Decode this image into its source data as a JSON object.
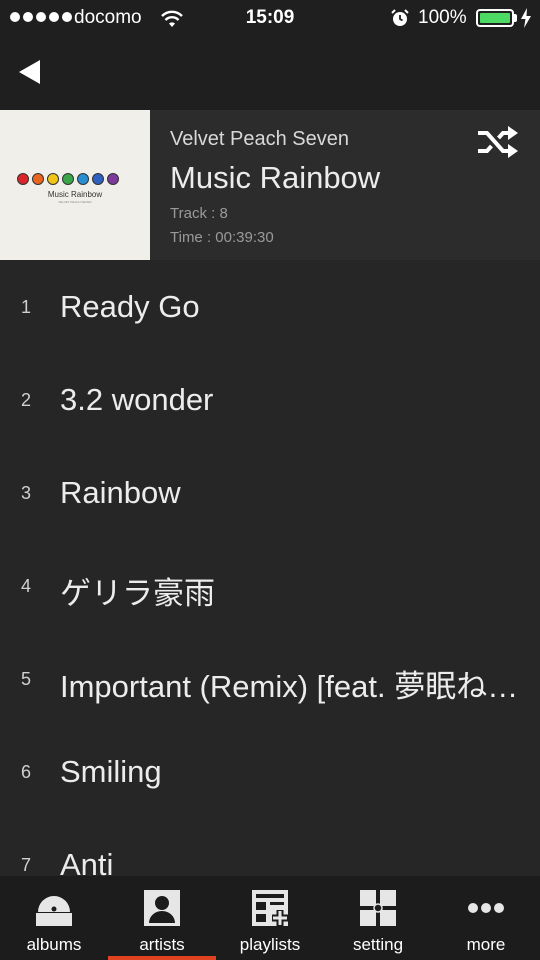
{
  "status_bar": {
    "carrier": "docomo",
    "time": "15:09",
    "battery": "100%",
    "battery_fill_fraction": 1.0,
    "battery_color": "#4cd964"
  },
  "nav": {
    "back_icon": "back-arrow-icon"
  },
  "album": {
    "artist": "Velvet Peach Seven",
    "title": "Music Rainbow",
    "track_count": "Track : 8",
    "time": "Time : 00:39:30",
    "art_title": "Music Rainbow",
    "art_subtitle": "VELVET PEACH SEVEN",
    "shuffle_icon": "shuffle-icon"
  },
  "tracks": [
    {
      "number": "1",
      "title": "Ready Go"
    },
    {
      "number": "2",
      "title": "3.2 wonder"
    },
    {
      "number": "3",
      "title": "Rainbow"
    },
    {
      "number": "4",
      "title": "ゲリラ豪雨"
    },
    {
      "number": "5",
      "title": "Important (Remix) [feat. 夢眠ね…"
    },
    {
      "number": "6",
      "title": "Smiling"
    },
    {
      "number": "7",
      "title": "Anti"
    }
  ],
  "tabs": [
    {
      "label": "albums",
      "icon": "albums-icon",
      "active": false
    },
    {
      "label": "artists",
      "icon": "artists-icon",
      "active": true
    },
    {
      "label": "playlists",
      "icon": "playlists-icon",
      "active": false
    },
    {
      "label": "setting",
      "icon": "setting-icon",
      "active": false
    },
    {
      "label": "more",
      "icon": "more-icon",
      "active": false
    }
  ],
  "colors": {
    "background": "#262626",
    "header_background": "#2c2c2c",
    "bar_background": "#1c1c1c",
    "accent": "#e0411e"
  }
}
